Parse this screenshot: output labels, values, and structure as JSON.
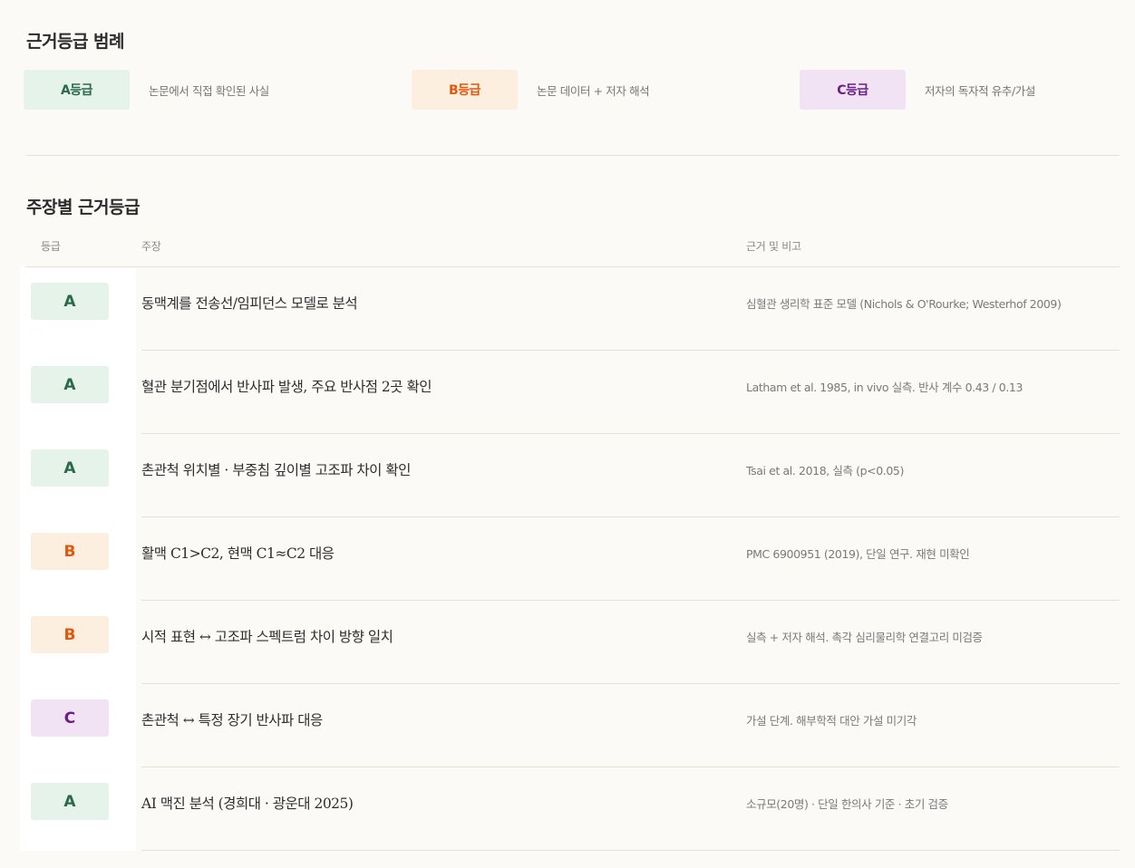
{
  "legend": {
    "title": "근거등급 범례",
    "items": [
      {
        "grade": "A",
        "label": "A등급",
        "desc": "논문에서 직접 확인된 사실"
      },
      {
        "grade": "B",
        "label": "B등급",
        "desc": "논문 데이터 + 저자 해석"
      },
      {
        "grade": "C",
        "label": "C등급",
        "desc": "저자의 독자적 유추/가설"
      }
    ]
  },
  "table": {
    "title": "주장별 근거등급",
    "headers": {
      "grade": "등급",
      "claim": "주장",
      "note": "근거 및 비고"
    },
    "rows": [
      {
        "grade": "A",
        "claim": "동맥계를 전송선/임피던스 모델로 분석",
        "note": "심혈관 생리학 표준 모델 (Nichols & O'Rourke; Westerhof 2009)"
      },
      {
        "grade": "A",
        "claim": "혈관 분기점에서 반사파 발생, 주요 반사점 2곳 확인",
        "note": "Latham et al. 1985, in vivo 실측. 반사 계수 0.43 / 0.13"
      },
      {
        "grade": "A",
        "claim": "촌관척 위치별 · 부중침 깊이별 고조파 차이 확인",
        "note": "Tsai et al. 2018, 실측 (p<0.05)"
      },
      {
        "grade": "B",
        "claim": "활맥 C1>C2, 현맥 C1≈C2 대응",
        "note": "PMC 6900951 (2019), 단일 연구. 재현 미확인"
      },
      {
        "grade": "B",
        "claim": "시적 표현 ↔ 고조파 스펙트럼 차이 방향 일치",
        "note": "실측 + 저자 해석. 촉각 심리물리학 연결고리 미검증"
      },
      {
        "grade": "C",
        "claim": "촌관척 ↔ 특정 장기 반사파 대응",
        "note": "가설 단계. 해부학적 대안 가설 미기각"
      },
      {
        "grade": "A",
        "claim": "AI 맥진 분석 (경희대 · 광운대 2025)",
        "note": "소규모(20명) · 단일 한의사 기준 · 초기 검증"
      }
    ]
  },
  "colors": {
    "A_bg": "#e6f3ea",
    "A_text": "#2a6a48",
    "B_bg": "#fdefdf",
    "B_text": "#e0580f",
    "C_bg": "#f1e3f4",
    "C_text": "#6b1f86"
  }
}
